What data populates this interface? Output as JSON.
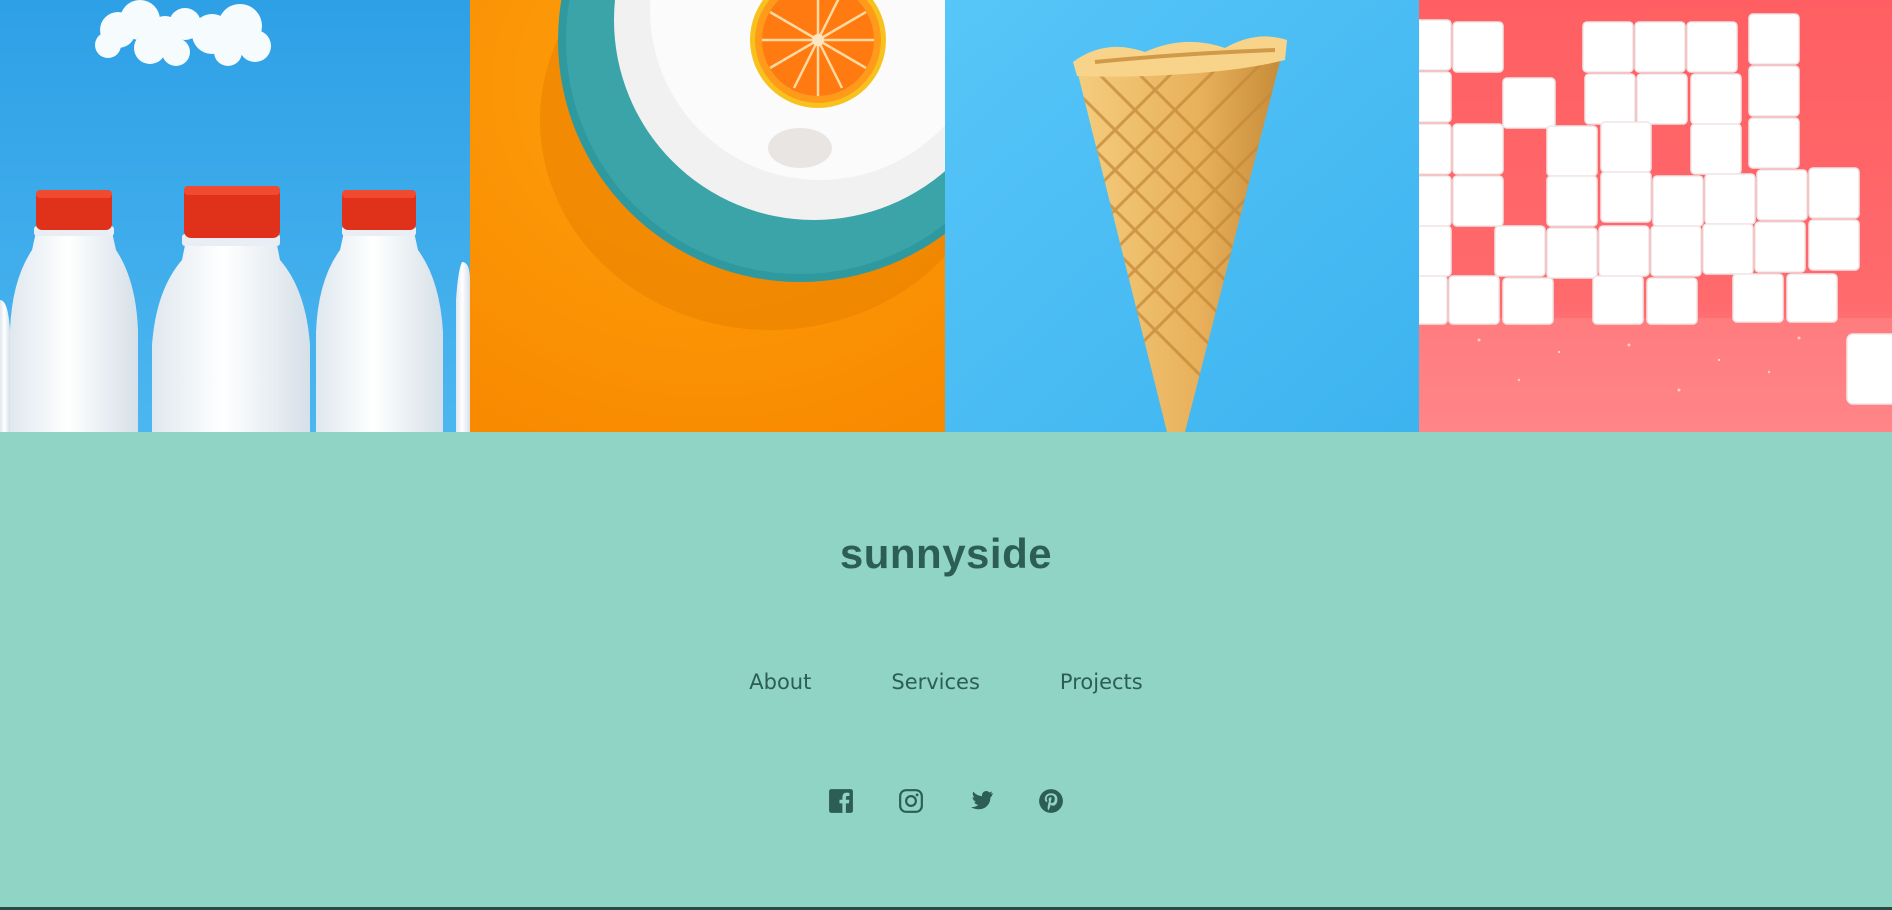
{
  "gallery": {
    "images": [
      {
        "subject": "milk-bottles",
        "bg": "#3aa9ea",
        "accent": "#e0311b"
      },
      {
        "subject": "orange-plate",
        "bg": "#ff9a08",
        "accent": "#3aa4a9"
      },
      {
        "subject": "waffle-cone",
        "bg": "#4dbff5",
        "accent": "#e2a94e"
      },
      {
        "subject": "sugar-cubes",
        "bg": "#ff6a6a",
        "accent": "#ffffff"
      }
    ]
  },
  "footer": {
    "brand": "sunnyside",
    "nav": [
      {
        "label": "About"
      },
      {
        "label": "Services"
      },
      {
        "label": "Projects"
      }
    ],
    "social": [
      "facebook-icon",
      "instagram-icon",
      "twitter-icon",
      "pinterest-icon"
    ],
    "colors": {
      "background": "#90d4c5",
      "text": "#2c5e53"
    }
  }
}
